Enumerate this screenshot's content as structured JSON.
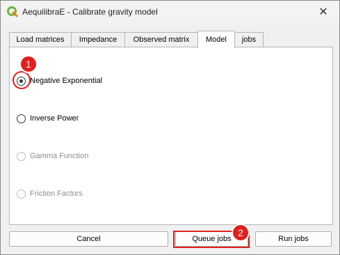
{
  "window": {
    "title": "AequilibraE - Calibrate gravity model",
    "close_symbol": "✕"
  },
  "tabs": [
    {
      "label": "Load matrices"
    },
    {
      "label": "Impedance"
    },
    {
      "label": "Observed matrix"
    },
    {
      "label": "Model",
      "active": true
    },
    {
      "label": "jobs"
    }
  ],
  "model_options": [
    {
      "label": "Negative Exponential",
      "checked": true,
      "enabled": true
    },
    {
      "label": "Inverse Power",
      "checked": false,
      "enabled": true
    },
    {
      "label": "Gamma Function",
      "checked": false,
      "enabled": false
    },
    {
      "label": "Friction Factors",
      "checked": false,
      "enabled": false
    }
  ],
  "buttons": {
    "cancel": "Cancel",
    "queue": "Queue jobs",
    "run": "Run jobs"
  },
  "annotations": {
    "step1": "1",
    "step2": "2",
    "accent_color": "#e0201c"
  }
}
